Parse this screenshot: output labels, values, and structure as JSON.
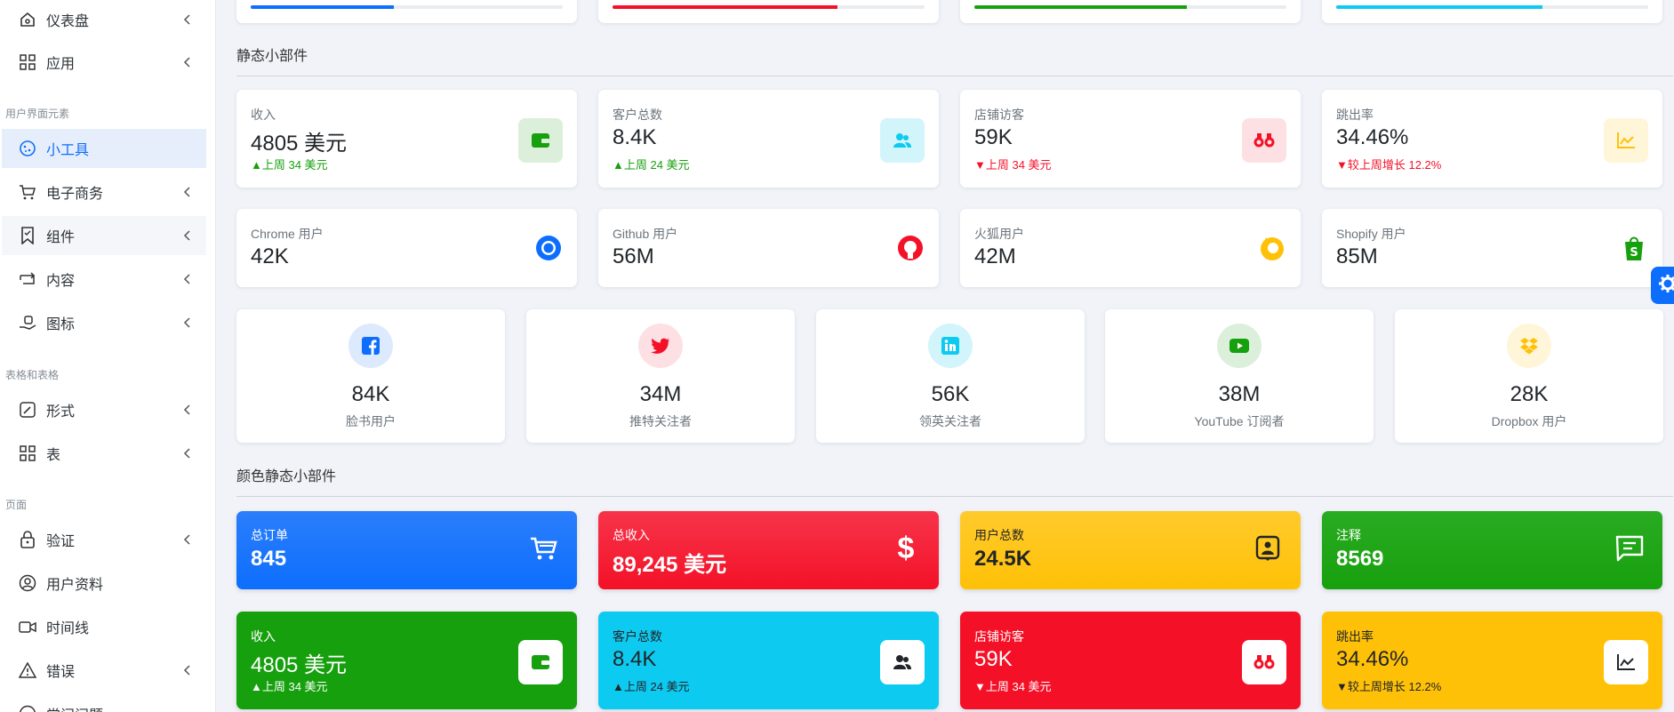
{
  "sidebar": {
    "items_top": [
      {
        "label": "仪表盘",
        "icon": "home-icon"
      },
      {
        "label": "应用",
        "icon": "apps-grid-icon"
      }
    ],
    "section_ui": "用户界面元素",
    "items_ui": [
      {
        "label": "小工具",
        "icon": "cookie-icon"
      },
      {
        "label": "电子商务",
        "icon": "cart-icon"
      },
      {
        "label": "组件",
        "icon": "bookmark-icon"
      },
      {
        "label": "内容",
        "icon": "repeat-icon"
      },
      {
        "label": "图标",
        "icon": "donate-icon"
      }
    ],
    "section_forms": "表格和表格",
    "items_forms": [
      {
        "label": "形式",
        "icon": "edit-icon"
      },
      {
        "label": "表",
        "icon": "grid-icon"
      }
    ],
    "section_pages": "页面",
    "items_pages": [
      {
        "label": "验证",
        "icon": "lock-icon"
      },
      {
        "label": "用户资料",
        "icon": "user-circle-icon"
      },
      {
        "label": "时间线",
        "icon": "video-icon"
      },
      {
        "label": "错误",
        "icon": "error-triangle-icon"
      },
      {
        "label": "常问问题",
        "icon": "help-circle-icon"
      }
    ]
  },
  "top_progress": [
    {
      "color": "#0d6efd",
      "value": 0.46
    },
    {
      "color": "#f41127",
      "value": 0.72
    },
    {
      "color": "#17a00e",
      "value": 0.68
    },
    {
      "color": "#0dcaf0",
      "value": 0.66
    }
  ],
  "static_widgets": {
    "title": "静态小部件",
    "row1": [
      {
        "label": "收入",
        "value": "4805 美元",
        "trend": "上周 34 美元",
        "direction": "up",
        "icon": "wallet-icon",
        "color": "#17a00e",
        "bg": "#dcefda"
      },
      {
        "label": "客户总数",
        "value": "8.4K",
        "trend": "上周 24 美元",
        "direction": "up",
        "icon": "users-icon",
        "color": "#0dcaf0",
        "bg": "#d2f4fb"
      },
      {
        "label": "店铺访客",
        "value": "59K",
        "trend": "上周 34 美元",
        "direction": "down",
        "icon": "binoculars-icon",
        "color": "#f41127",
        "bg": "#fde0e3"
      },
      {
        "label": "跳出率",
        "value": "34.46%",
        "trend": "较上周增长 12.2%",
        "direction": "down",
        "icon": "line-chart-icon",
        "color": "#ffc107",
        "bg": "#fff5d8"
      }
    ],
    "row2": [
      {
        "label": "Chrome 用户",
        "value": "42K",
        "icon": "chrome-icon"
      },
      {
        "label": "Github 用户",
        "value": "56M",
        "icon": "github-icon"
      },
      {
        "label": "火狐用户",
        "value": "42M",
        "icon": "firefox-icon"
      },
      {
        "label": "Shopify 用户",
        "value": "85M",
        "icon": "shopify-icon"
      }
    ],
    "social": [
      {
        "value": "84K",
        "label": "脸书用户",
        "icon": "facebook-icon",
        "color": "#0d6efd",
        "bg": "#dde9fd"
      },
      {
        "value": "34M",
        "label": "推特关注者",
        "icon": "twitter-icon",
        "color": "#f41127",
        "bg": "#fde0e3"
      },
      {
        "value": "56K",
        "label": "领英关注者",
        "icon": "linkedin-icon",
        "color": "#0dcaf0",
        "bg": "#d2f4fb"
      },
      {
        "value": "38M",
        "label": "YouTube 订阅者",
        "icon": "youtube-icon",
        "color": "#17a00e",
        "bg": "#dcefda"
      },
      {
        "value": "28K",
        "label": "Dropbox 用户",
        "icon": "dropbox-icon",
        "color": "#ffc107",
        "bg": "#fff5d8"
      }
    ]
  },
  "color_widgets": {
    "title": "颜色静态小部件",
    "row1": [
      {
        "label": "总订单",
        "value": "845",
        "icon": "cart-icon",
        "bg": "#0d6efd",
        "text": "#ffffff"
      },
      {
        "label": "总收入",
        "value": "89,245 美元",
        "icon": "dollar-icon",
        "bg": "#f41127",
        "text": "#ffffff"
      },
      {
        "label": "用户总数",
        "value": "24.5K",
        "icon": "user-badge-icon",
        "bg": "#ffc107",
        "text": "#212529"
      },
      {
        "label": "注释",
        "value": "8569",
        "icon": "comment-icon",
        "bg": "#17a00e",
        "text": "#ffffff"
      }
    ],
    "row2": [
      {
        "label": "收入",
        "value": "4805 美元",
        "trend": "上周 34 美元",
        "direction": "up",
        "icon": "wallet-icon",
        "bg": "#17a00e",
        "text": "#ffffff",
        "iconColor": "#17a00e"
      },
      {
        "label": "客户总数",
        "value": "8.4K",
        "trend": "上周 24 美元",
        "direction": "up",
        "icon": "users-icon",
        "bg": "#0dcaf0",
        "text": "#212529",
        "iconColor": "#212529"
      },
      {
        "label": "店铺访客",
        "value": "59K",
        "trend": "上周 34 美元",
        "direction": "down",
        "icon": "binoculars-icon",
        "bg": "#f41127",
        "text": "#ffffff",
        "iconColor": "#f41127"
      },
      {
        "label": "跳出率",
        "value": "34.46%",
        "trend": "较上周增长 12.2%",
        "direction": "down",
        "icon": "line-chart-icon",
        "bg": "#ffc107",
        "text": "#212529",
        "iconColor": "#212529"
      }
    ]
  },
  "settings_button": {
    "icon": "gear-icon",
    "color": "#0d6efd"
  }
}
